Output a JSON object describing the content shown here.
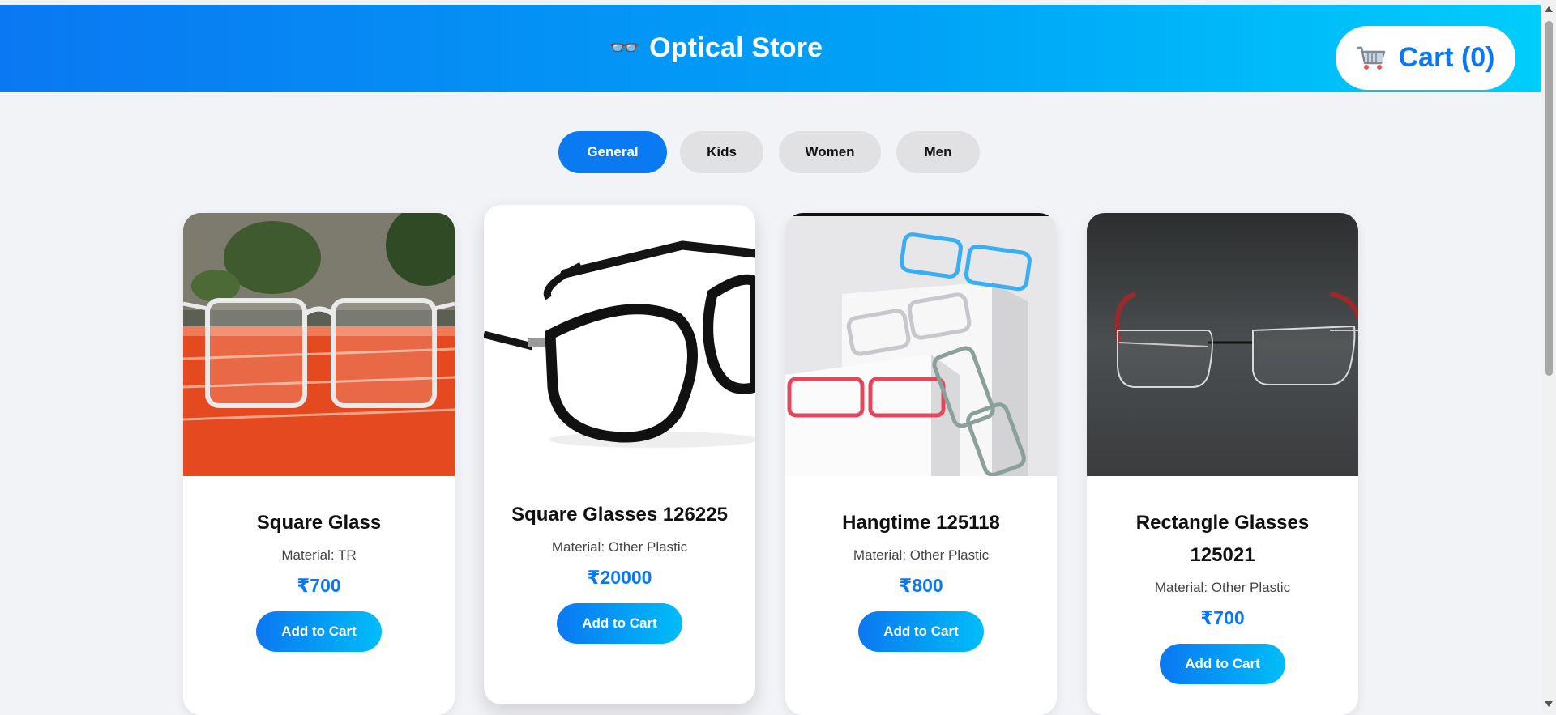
{
  "header": {
    "brand_icon": "👓",
    "title": "Optical Store",
    "cart_label": "Cart (0)",
    "cart_icon": "cart-icon",
    "gradient": [
      "#0a78f2",
      "#00cdfb"
    ]
  },
  "tabs": [
    {
      "label": "General",
      "active": true
    },
    {
      "label": "Kids",
      "active": false
    },
    {
      "label": "Women",
      "active": false
    },
    {
      "label": "Men",
      "active": false
    }
  ],
  "products": [
    {
      "name": "Square Glass",
      "material": "Material: TR",
      "price": "₹700",
      "button": "Add to Cart"
    },
    {
      "name": "Square Glasses 126225",
      "material": "Material: Other Plastic",
      "price": "₹20000",
      "button": "Add to Cart"
    },
    {
      "name": "Hangtime 125118",
      "material": "Material: Other Plastic",
      "price": "₹800",
      "button": "Add to Cart"
    },
    {
      "name": "Rectangle Glasses 125021",
      "material": "Material: Other Plastic",
      "price": "₹700",
      "button": "Add to Cart"
    }
  ],
  "colors": {
    "accent": "#0a78f2",
    "tab_inactive": "#e1e1e3",
    "page_bg": "#f2f3f7"
  }
}
